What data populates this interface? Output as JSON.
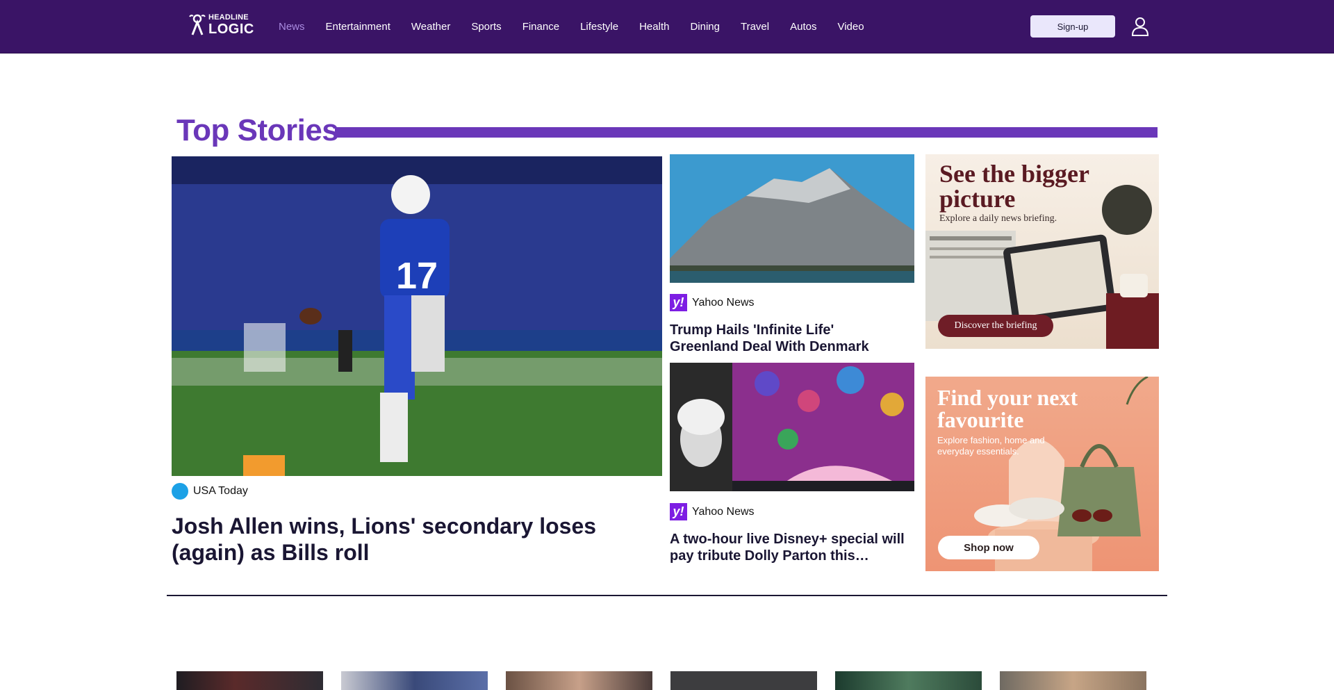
{
  "header": {
    "logo_top": "HEADLINE",
    "logo_bottom": "LOGIC",
    "nav": [
      {
        "label": "News"
      },
      {
        "label": "Entertainment"
      },
      {
        "label": "Weather"
      },
      {
        "label": "Sports"
      },
      {
        "label": "Finance"
      },
      {
        "label": "Lifestyle"
      },
      {
        "label": "Health"
      },
      {
        "label": "Dining"
      },
      {
        "label": "Travel"
      },
      {
        "label": "Autos"
      },
      {
        "label": "Video"
      }
    ],
    "signup_label": "Sign-up"
  },
  "top_stories": {
    "title": "Top Stories",
    "main": {
      "source": "USA Today",
      "headline": "Josh Allen wins, Lions' secondary loses (again) as Bills roll"
    },
    "side": [
      {
        "source": "Yahoo News",
        "headline": "Trump Hails 'Infinite Life' Greenland Deal With Denmark"
      },
      {
        "source": "Yahoo News",
        "headline": "A two-hour live Disney+ special will pay tribute Dolly Parton this…"
      }
    ],
    "ads": [
      {
        "headline": "See the bigger picture",
        "sub": "Explore a daily news briefing.",
        "cta": "Discover the briefing"
      },
      {
        "headline": "Find your next favourite",
        "sub": "Explore fashion, home and everyday essentials.",
        "cta": "Shop now"
      }
    ]
  },
  "colors": {
    "header_bg": "#3a1466",
    "accent": "#6a37b9",
    "nav_active": "#a98be0"
  }
}
